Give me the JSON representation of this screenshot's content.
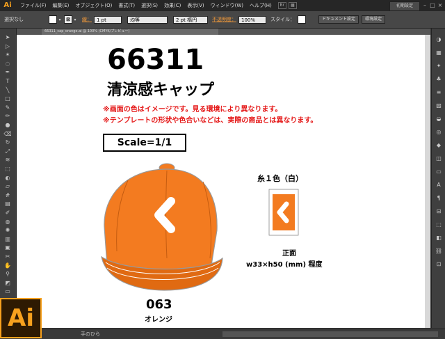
{
  "app": {
    "logo": "Ai"
  },
  "menu": [
    "ファイル(F)",
    "編集(E)",
    "オブジェクト(O)",
    "書式(T)",
    "選択(S)",
    "効果(C)",
    "表示(V)",
    "ウィンドウ(W)",
    "ヘルプ(H)"
  ],
  "workspace": "初期設定",
  "window_controls": [
    "–",
    "□",
    "×"
  ],
  "control": {
    "selection": "選択なし",
    "stroke_label": "線：",
    "stroke_weight": "1 pt",
    "stroke_style": "均等",
    "brush": "2 pt 楕円",
    "opacity_label": "不透明度：",
    "opacity_value": "100%",
    "style_label": "スタイル：",
    "doc_settings": "ドキュメント設定",
    "prefs": "環境設定"
  },
  "document": {
    "tab_title": "66311_cap_orange.ai @ 100% (CMYK/プレビュー)",
    "product_number": "66311",
    "product_name": "清涼感キャップ",
    "notice_1": "※画面の色はイメージです。見る環境により異なります。",
    "notice_2": "※テンプレートの形状や色合いなどは、実際の商品とは異なります。",
    "scale": "Scale=1/1",
    "color_code": "063",
    "color_name": "オレンジ",
    "thread_label": "糸１色（白）",
    "front_label": "正面",
    "size_label": "w33×h50 (mm) 程度"
  },
  "colors": {
    "cap": "#f37b20",
    "cap_dark": "#e06a12",
    "accent": "#f7a11e",
    "notice": "#e51a1a"
  },
  "status": {
    "tool": "手のひら"
  },
  "icons": {
    "left": [
      "selection-icon",
      "direct-selection-icon",
      "magic-wand-icon",
      "lasso-icon",
      "pen-icon",
      "type-icon",
      "line-icon",
      "rectangle-icon",
      "paintbrush-icon",
      "pencil-icon",
      "blob-brush-icon",
      "eraser-icon",
      "rotate-icon",
      "scale-icon",
      "width-icon",
      "free-transform-icon",
      "shape-builder-icon",
      "perspective-icon",
      "mesh-icon",
      "gradient-icon",
      "eyedropper-icon",
      "blend-icon",
      "symbol-sprayer-icon",
      "graph-icon",
      "artboard-icon",
      "slice-icon",
      "hand-icon",
      "zoom-icon",
      "fill-stroke-icon",
      "screen-mode-icon"
    ],
    "right": [
      "color-panel-icon",
      "swatches-icon",
      "brushes-icon",
      "symbols-icon",
      "stroke-icon",
      "gradient-panel-icon",
      "transparency-icon",
      "appearance-icon",
      "graphic-styles-icon",
      "layers-icon",
      "artboards-icon",
      "character-icon",
      "paragraph-icon",
      "align-icon",
      "transform-icon",
      "pathfinder-icon",
      "links-icon",
      "navigator-icon"
    ]
  }
}
